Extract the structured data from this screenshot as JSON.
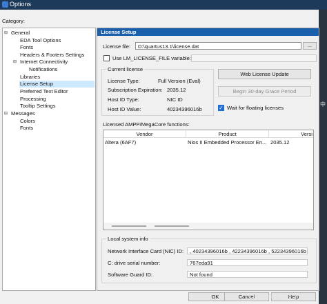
{
  "window": {
    "title": "Options"
  },
  "category_label": "Category:",
  "tree": {
    "items": [
      "General",
      "EDA Tool Options",
      "Fonts",
      "Headers & Footers Settings",
      "Internet Connectivity",
      "Notifications",
      "Libraries",
      "License Setup",
      "Preferred Text Editor",
      "Processing",
      "Tooltip Settings",
      "Messages",
      "Colors",
      "Fonts"
    ],
    "selected": "License Setup"
  },
  "panel": {
    "title": "License Setup",
    "license_file_label": "License file:",
    "license_file_value": "D:\\quartus13.1\\license.dat",
    "browse_label": "...",
    "use_env_label": "Use LM_LICENSE_FILE variable:",
    "current_license": {
      "title": "Current license",
      "rows": [
        {
          "label": "License Type:",
          "value": "Full Version (Eval)"
        },
        {
          "label": "Subscription Expiration:",
          "value": "2035.12"
        },
        {
          "label": "Host ID Type:",
          "value": "NIC ID"
        },
        {
          "label": "Host ID Value:",
          "value": "40234396016b"
        }
      ]
    },
    "web_update_label": "Web License Update",
    "grace_label": "Begin 30-day Grace Period",
    "wait_label": "Wait for floating licenses",
    "wait_checked": true,
    "ampp": {
      "title": "Licensed AMPP/MegaCore functions:",
      "columns": [
        "Vendor",
        "Product",
        "Versi"
      ],
      "rows": [
        {
          "vendor": "Altera (6AF7)",
          "product": "Nios II Embedded Processor En...",
          "version": "2035.12"
        }
      ]
    },
    "local_info": {
      "title": "Local system info",
      "rows": [
        {
          "label": "Network Interface Card (NIC) ID:",
          "value": ", 40234396016b , 42234396016b , 52234396016b"
        },
        {
          "label": "C: drive serial number:",
          "value": "767eda91"
        },
        {
          "label": "Software Guard ID:",
          "value": "Not found"
        }
      ]
    }
  },
  "buttons": {
    "ok": "OK",
    "cancel": "Cancel",
    "help": "Help"
  },
  "watermark": "CSDN @周末在下雨",
  "right_strip_char": "中",
  "colors": {
    "accent": "#1b5fab",
    "selection": "#cde8ff"
  }
}
